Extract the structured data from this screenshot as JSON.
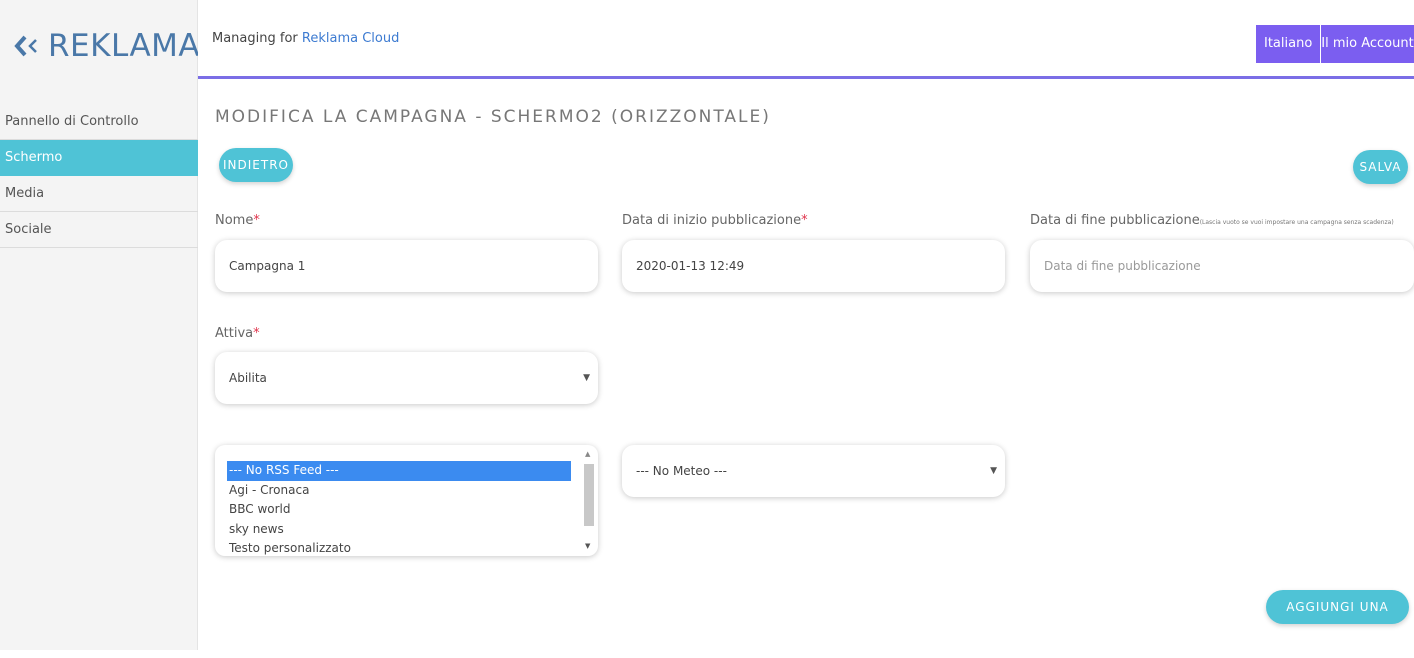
{
  "brand": {
    "name": "REKLAMA",
    "logo_icon": "double-chevron-left-icon",
    "color": "#4a78a8"
  },
  "sidebar": {
    "items": [
      {
        "label": "Pannello di Controllo",
        "active": false
      },
      {
        "label": "Schermo",
        "active": true
      },
      {
        "label": "Media",
        "active": false
      },
      {
        "label": "Sociale",
        "active": false
      }
    ]
  },
  "header": {
    "managing_prefix": "Managing for",
    "managing_link": "Reklama Cloud",
    "language_button": "Italiano",
    "account_button": "Il mio Account",
    "accent_color": "#7b5ef0"
  },
  "page": {
    "title": "MODIFICA LA CAMPAGNA - SCHERMO2 (ORIZZONTALE)",
    "back_button": "INDIETRO",
    "save_button": "SALVA",
    "add_slide_button": "AGGIUNGI UNA SLIDE",
    "button_color": "#4fc3d6"
  },
  "form": {
    "nome": {
      "label": "Nome",
      "required_mark": "*",
      "value": "Campagna 1"
    },
    "data_inizio": {
      "label": "Data di inizio pubblicazione",
      "required_mark": "*",
      "value": "2020-01-13 12:49"
    },
    "data_fine": {
      "label": "Data di fine pubblicazione",
      "hint": "(Lascia vuoto se vuoi impostare una campagna senza scadenza)",
      "placeholder": "Data di fine pubblicazione",
      "value": ""
    },
    "attiva": {
      "label": "Attiva",
      "required_mark": "*",
      "selected": "Abilita"
    },
    "rss_feed": {
      "options": [
        "--- No RSS Feed ---",
        "Agi - Cronaca",
        "BBC world",
        "sky news",
        "Testo personalizzato"
      ],
      "selected": "--- No RSS Feed ---"
    },
    "meteo": {
      "selected": "--- No Meteo ---"
    }
  }
}
